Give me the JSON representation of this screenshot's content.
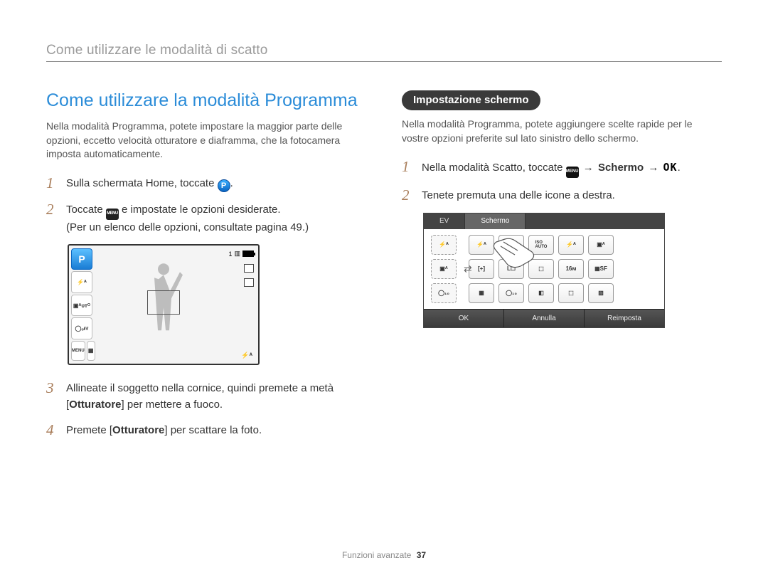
{
  "header": {
    "breadcrumb": "Come utilizzare le modalità di scatto"
  },
  "left": {
    "title": "Come utilizzare la modalità Programma",
    "intro": "Nella modalità Programma, potete impostare la maggior parte delle opzioni, eccetto velocità otturatore e diaframma, che la fotocamera imposta automaticamente.",
    "step1": "Sulla schermata Home, toccate ",
    "step1_tail": ".",
    "step2a": "Toccate ",
    "step2b": " e impostate le opzioni desiderate.",
    "step2c": "(Per un elenco delle opzioni, consultate pagina 49.)",
    "step3a": "Allineate il soggetto nella cornice, quindi premete a metà [",
    "step3b": "Otturatore",
    "step3c": "] per mettere a fuoco.",
    "step4a": "Premete [",
    "step4b": "Otturatore",
    "step4c": "] per scattare la foto."
  },
  "scr1": {
    "p": "P",
    "btn_flash": "⚡ᴬ",
    "btn_auto": "▣ᴬᴜᴛᴼ",
    "btn_off": "◯ₒғғ",
    "btn_menu": "MENU",
    "btn_disp": "▦",
    "status_count": "1",
    "flash_indicator": "⚡ᴬ"
  },
  "right": {
    "pill": "Impostazione schermo",
    "intro": "Nella modalità Programma, potete aggiungere scelte rapide per le vostre opzioni preferite sul lato sinistro dello schermo.",
    "step1a": "Nella modalità Scatto, toccate ",
    "step1b": " → ",
    "step1c": "Schermo",
    "step1d": " → ",
    "step1_tail": ".",
    "step2": "Tenete premuta una delle icone a destra."
  },
  "scr2": {
    "tab1": "EV",
    "tab2": "Schermo",
    "left1": "⚡ᴬ",
    "left2": "▣ᴬ",
    "left3": "◯₁₀",
    "g": [
      "⚡ᴬ",
      "AWB",
      "ISO\nAUTO",
      "⚡ᴬ",
      "▣ᴬ",
      "[+]",
      "L☐",
      "⬚",
      "16ᴍ",
      "▦SF",
      "▦",
      "◯₁₀",
      "◧",
      "⬚",
      "▧"
    ],
    "ok": "OK",
    "cancel": "Annulla",
    "reset": "Reimposta"
  },
  "icons": {
    "p": "P",
    "menu": "MENU",
    "ok": "OK"
  },
  "footer": {
    "section": "Funzioni avanzate",
    "page": "37"
  }
}
